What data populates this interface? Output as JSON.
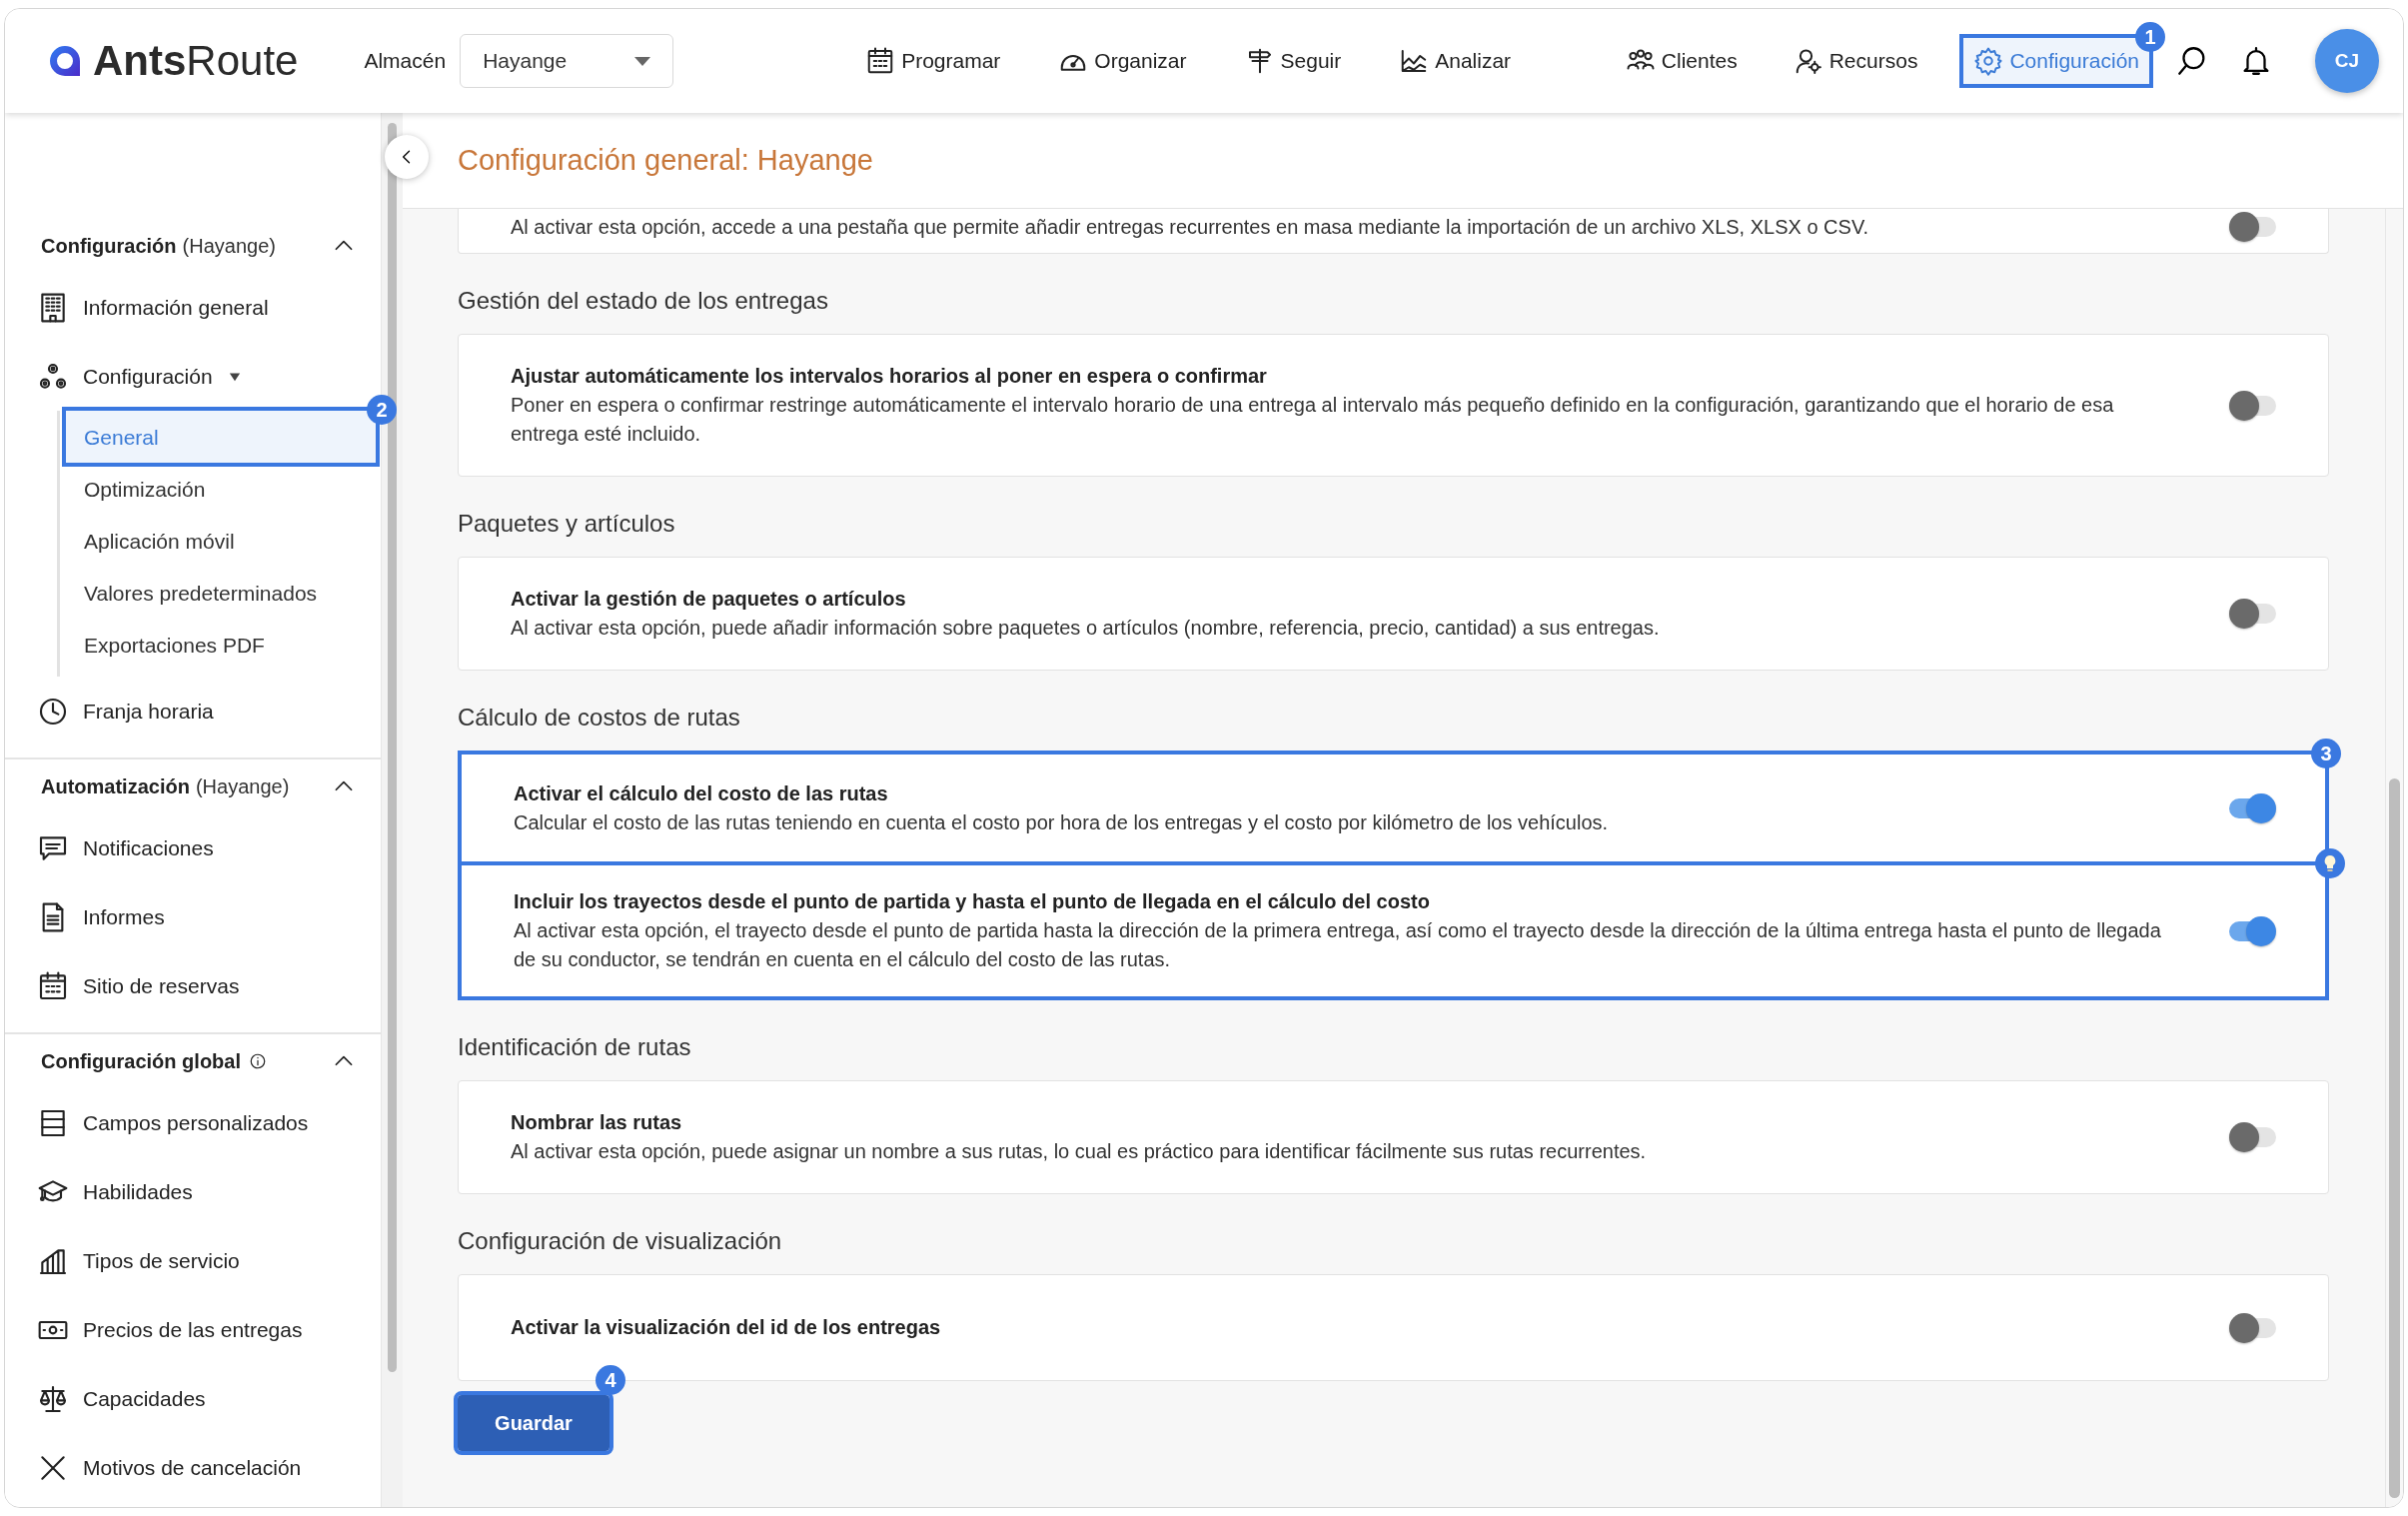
{
  "header": {
    "logo": {
      "bold": "Ants",
      "light": "Route"
    },
    "warehouse_label": "Almacén",
    "warehouse_select": {
      "value": "Hayange"
    },
    "nav_main": [
      {
        "label": "Programar",
        "selected": false
      },
      {
        "label": "Organizar",
        "selected": false
      },
      {
        "label": "Seguir",
        "selected": false
      },
      {
        "label": "Analizar",
        "selected": false
      }
    ],
    "nav_side": [
      {
        "label": "Clientes",
        "selected": false
      },
      {
        "label": "Recursos",
        "selected": false
      },
      {
        "label": "Configuración",
        "selected": true,
        "callout": "1"
      }
    ],
    "avatar": "CJ"
  },
  "sidebar": {
    "groups": [
      {
        "title": "Configuración",
        "suffix": "(Hayange)",
        "info": false,
        "expanded": true,
        "items": [
          {
            "label": "Información general"
          },
          {
            "label": "Configuración",
            "expanded": true,
            "children": [
              {
                "label": "General",
                "selected": true,
                "callout": "2"
              },
              {
                "label": "Optimización",
                "selected": false
              },
              {
                "label": "Aplicación móvil",
                "selected": false
              },
              {
                "label": "Valores predeterminados",
                "selected": false
              },
              {
                "label": "Exportaciones PDF",
                "selected": false
              }
            ]
          },
          {
            "label": "Franja horaria"
          }
        ]
      },
      {
        "title": "Automatización",
        "suffix": "(Hayange)",
        "info": false,
        "expanded": true,
        "items": [
          {
            "label": "Notificaciones"
          },
          {
            "label": "Informes"
          },
          {
            "label": "Sitio de reservas"
          }
        ]
      },
      {
        "title": "Configuración global",
        "info": true,
        "expanded": true,
        "items": [
          {
            "label": "Campos personalizados"
          },
          {
            "label": "Habilidades"
          },
          {
            "label": "Tipos de servicio"
          },
          {
            "label": "Precios de las entregas"
          },
          {
            "label": "Capacidades"
          },
          {
            "label": "Motivos de cancelación"
          }
        ]
      }
    ]
  },
  "page_title": "Configuración general: Hayange",
  "sections": [
    {
      "cards": [
        {
          "description": "Al activar esta opción, accede a una pestaña que permite añadir entregas recurrentes en masa mediante la importación de un archivo XLS, XLSX o CSV.",
          "on": false
        }
      ]
    },
    {
      "heading": "Gestión del estado de los entregas",
      "cards": [
        {
          "title": "Ajustar automáticamente los intervalos horarios al poner en espera o confirmar",
          "description": "Poner en espera o confirmar restringe automáticamente el intervalo horario de una entrega al intervalo más pequeño definido en la configuración, garantizando que el horario de esa entrega esté incluido.",
          "on": false
        }
      ]
    },
    {
      "heading": "Paquetes y artículos",
      "cards": [
        {
          "title": "Activar la gestión de paquetes o artículos",
          "description": "Al activar esta opción, puede añadir información sobre paquetes o artículos (nombre, referencia, precio, cantidad) a sus entregas.",
          "on": false
        }
      ]
    },
    {
      "heading": "Cálculo de costos de rutas",
      "callout": "3",
      "cards": [
        {
          "title": "Activar el cálculo del costo de las rutas",
          "description": "Calcular el costo de las rutas teniendo en cuenta el costo por hora de los entregas y el costo por kilómetro de los vehículos.",
          "on": true
        },
        {
          "title": "Incluir los trayectos desde el punto de partida y hasta el punto de llegada en el cálculo del costo",
          "description": "Al activar esta opción, el trayecto desde el punto de partida hasta la dirección de la primera entrega, así como el trayecto desde la dirección de la última entrega hasta el punto de llegada de su conductor, se tendrán en cuenta en el cálculo del costo de las rutas.",
          "on": true,
          "hint": true
        }
      ]
    },
    {
      "heading": "Identificación de rutas",
      "cards": [
        {
          "title": "Nombrar las rutas",
          "description": "Al activar esta opción, puede asignar un nombre a sus rutas, lo cual es práctico para identificar fácilmente sus rutas recurrentes.",
          "on": false
        }
      ]
    },
    {
      "heading": "Configuración de visualización",
      "cards": [
        {
          "title": "Activar la visualización del id de los entregas",
          "on": false
        }
      ]
    }
  ],
  "save_button": {
    "label": "Guardar",
    "callout": "4"
  }
}
